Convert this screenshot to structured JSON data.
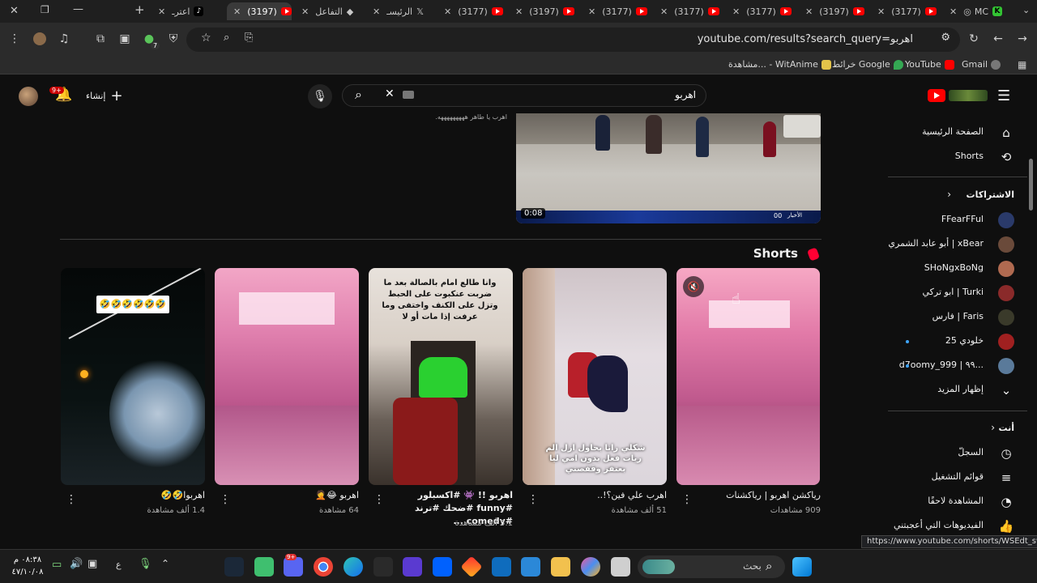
{
  "browser": {
    "tabs": [
      {
        "title": "MC",
        "kind": "other"
      },
      {
        "title": "(3177)",
        "kind": "youtube"
      },
      {
        "title": "(3197)",
        "kind": "youtube"
      },
      {
        "title": "(3177)",
        "kind": "youtube"
      },
      {
        "title": "(3177)",
        "kind": "youtube"
      },
      {
        "title": "(3177)",
        "kind": "youtube"
      },
      {
        "title": "(3197)",
        "kind": "youtube"
      },
      {
        "title": "(3177)",
        "kind": "youtube"
      },
      {
        "title": "الرئيسـ",
        "kind": "x"
      },
      {
        "title": "التفاعل",
        "kind": "other"
      },
      {
        "title": "(3197)",
        "kind": "youtube"
      },
      {
        "title": "اعترـ",
        "kind": "tiktok"
      }
    ],
    "url": "youtube.com/results?search_query=اهربو",
    "bookmarks": [
      {
        "label": "Gmail",
        "color": "#ffffff"
      },
      {
        "label": "YouTube",
        "color": "#ff0000"
      },
      {
        "label": "خرائط Google",
        "color": "#34a853"
      },
      {
        "label": "مشاهدة... - WitAnime",
        "color": "#e3c34a"
      }
    ],
    "extension_badge": "7"
  },
  "masthead": {
    "search_value": "اهربو",
    "create_label": "إنشاء",
    "notification_count": "9+"
  },
  "sidebar": {
    "home": "الصفحة الرئيسية",
    "shorts": "Shorts",
    "subscriptions_heading": "الاشتراكات",
    "channels": [
      {
        "name": "FFearFFul",
        "color": "#2a3a6a",
        "dot": false
      },
      {
        "name": "أبو عابد الشمري | xBear",
        "color": "#6a4a3a",
        "dot": false
      },
      {
        "name": "SHoNgxBoNg",
        "color": "#b06a50",
        "dot": false
      },
      {
        "name": "ابو تركي | Turki",
        "color": "#8a2a2a",
        "dot": false
      },
      {
        "name": "فارس | Faris",
        "color": "#3a3a2a",
        "dot": false
      },
      {
        "name": "خلودي 25",
        "color": "#a02020",
        "dot": true
      },
      {
        "name": "d7oomy_999 | ٩٩...",
        "color": "#5a7a9a",
        "dot": true
      }
    ],
    "show_more": "إظهار المزيد",
    "you_heading": "أنت",
    "you_items": [
      "السجلّ",
      "قوائم التشغيل",
      "المشاهدة لاحقًا",
      "الفيديوهات التي أعجبتني"
    ]
  },
  "top_result": {
    "snippet": "اهرب يا طاهر هههههههههه.",
    "duration": "0:08",
    "channel_badge": "الأخبار",
    "ticker": "00"
  },
  "shorts_section": {
    "heading": "Shorts",
    "items": [
      {
        "title": "رياكشن اهربو | رياكشنات",
        "views": "909 مشاهدات",
        "overlay": ""
      },
      {
        "title": "اهرب علي فين؟!..",
        "views": "51 ألف مشاهدة",
        "overlay": "شكلي رانا بحاول ازل الم ريات فعل بدون امي ليا بعتفز وقفصني"
      },
      {
        "title": "اهربو !! 👾 #اكسبلور #funny #ضحك #ترند #comedy ...",
        "views": "5.1 ألف مشاهدة",
        "overlay": "وانا طالع امام بالصالة بعد ما ضربت عنكبوت على الحبط وتزل على الكنف واختفى وما عرفت إذا مات أو لا"
      },
      {
        "title": "اهربو 😂🤦",
        "views": "64 مشاهدة",
        "overlay": ""
      },
      {
        "title": "اهربوا🤣🤣",
        "views": "1.4 ألف مشاهدة",
        "overlay": "🤣🤣🤣🤣🤣🤣"
      }
    ]
  },
  "status_url": "https://www.youtube.com/shorts/WSEdt_swYno",
  "taskbar": {
    "search_placeholder": "بحث",
    "time": "٠٨:٣٨ م",
    "date": "٤٧/١٠/٠٨",
    "lang": "ع",
    "discord_badge": "9+"
  }
}
